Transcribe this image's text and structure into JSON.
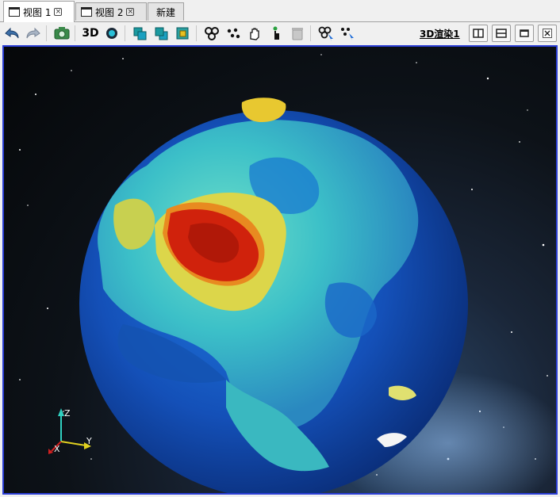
{
  "tabs": [
    {
      "label": "视图 1",
      "active": true,
      "has_close": true
    },
    {
      "label": "视图 2",
      "active": false,
      "has_close": true
    },
    {
      "label": "新建",
      "active": false,
      "has_close": false
    }
  ],
  "toolbar": {
    "label_3d": "3D",
    "render_label": "3D渲染1",
    "icons": [
      "undo-icon",
      "redo-icon",
      "camera-icon",
      "3d-mode",
      "sphere-view-icon",
      "layer-front-icon",
      "layer-back-icon",
      "layer-select-icon",
      "group-icon",
      "points-icon",
      "hand-pan-icon",
      "pointer-icon",
      "trash-icon",
      "pick-group-icon",
      "pick-points-icon"
    ]
  },
  "window_buttons": [
    "split-vertical-icon",
    "split-horizontal-icon",
    "maximize-icon",
    "close-icon"
  ],
  "axes": {
    "x": "X",
    "y": "Y",
    "z": "Z"
  },
  "colors": {
    "viewport_border": "#2c3fd6",
    "ocean_deep": "#0a3d9c",
    "ocean": "#1e6ed8",
    "land_low": "#3ec8c8",
    "land_mid": "#e0d84a",
    "land_high": "#d42a10"
  }
}
